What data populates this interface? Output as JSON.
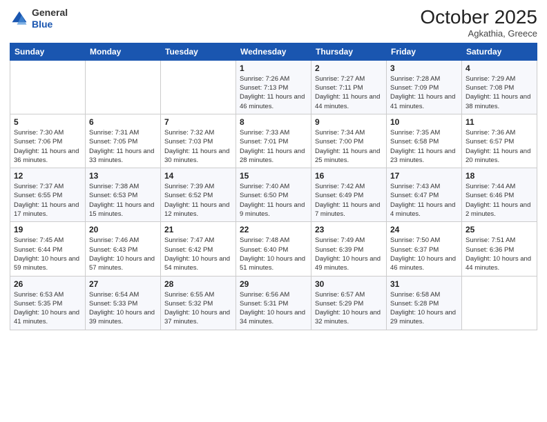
{
  "header": {
    "logo": {
      "general": "General",
      "blue": "Blue"
    },
    "title": "October 2025",
    "subtitle": "Agkathia, Greece"
  },
  "weekdays": [
    "Sunday",
    "Monday",
    "Tuesday",
    "Wednesday",
    "Thursday",
    "Friday",
    "Saturday"
  ],
  "weeks": [
    [
      {
        "day": null
      },
      {
        "day": null
      },
      {
        "day": null
      },
      {
        "day": 1,
        "sunrise": "Sunrise: 7:26 AM",
        "sunset": "Sunset: 7:13 PM",
        "daylight": "Daylight: 11 hours and 46 minutes."
      },
      {
        "day": 2,
        "sunrise": "Sunrise: 7:27 AM",
        "sunset": "Sunset: 7:11 PM",
        "daylight": "Daylight: 11 hours and 44 minutes."
      },
      {
        "day": 3,
        "sunrise": "Sunrise: 7:28 AM",
        "sunset": "Sunset: 7:09 PM",
        "daylight": "Daylight: 11 hours and 41 minutes."
      },
      {
        "day": 4,
        "sunrise": "Sunrise: 7:29 AM",
        "sunset": "Sunset: 7:08 PM",
        "daylight": "Daylight: 11 hours and 38 minutes."
      }
    ],
    [
      {
        "day": 5,
        "sunrise": "Sunrise: 7:30 AM",
        "sunset": "Sunset: 7:06 PM",
        "daylight": "Daylight: 11 hours and 36 minutes."
      },
      {
        "day": 6,
        "sunrise": "Sunrise: 7:31 AM",
        "sunset": "Sunset: 7:05 PM",
        "daylight": "Daylight: 11 hours and 33 minutes."
      },
      {
        "day": 7,
        "sunrise": "Sunrise: 7:32 AM",
        "sunset": "Sunset: 7:03 PM",
        "daylight": "Daylight: 11 hours and 30 minutes."
      },
      {
        "day": 8,
        "sunrise": "Sunrise: 7:33 AM",
        "sunset": "Sunset: 7:01 PM",
        "daylight": "Daylight: 11 hours and 28 minutes."
      },
      {
        "day": 9,
        "sunrise": "Sunrise: 7:34 AM",
        "sunset": "Sunset: 7:00 PM",
        "daylight": "Daylight: 11 hours and 25 minutes."
      },
      {
        "day": 10,
        "sunrise": "Sunrise: 7:35 AM",
        "sunset": "Sunset: 6:58 PM",
        "daylight": "Daylight: 11 hours and 23 minutes."
      },
      {
        "day": 11,
        "sunrise": "Sunrise: 7:36 AM",
        "sunset": "Sunset: 6:57 PM",
        "daylight": "Daylight: 11 hours and 20 minutes."
      }
    ],
    [
      {
        "day": 12,
        "sunrise": "Sunrise: 7:37 AM",
        "sunset": "Sunset: 6:55 PM",
        "daylight": "Daylight: 11 hours and 17 minutes."
      },
      {
        "day": 13,
        "sunrise": "Sunrise: 7:38 AM",
        "sunset": "Sunset: 6:53 PM",
        "daylight": "Daylight: 11 hours and 15 minutes."
      },
      {
        "day": 14,
        "sunrise": "Sunrise: 7:39 AM",
        "sunset": "Sunset: 6:52 PM",
        "daylight": "Daylight: 11 hours and 12 minutes."
      },
      {
        "day": 15,
        "sunrise": "Sunrise: 7:40 AM",
        "sunset": "Sunset: 6:50 PM",
        "daylight": "Daylight: 11 hours and 9 minutes."
      },
      {
        "day": 16,
        "sunrise": "Sunrise: 7:42 AM",
        "sunset": "Sunset: 6:49 PM",
        "daylight": "Daylight: 11 hours and 7 minutes."
      },
      {
        "day": 17,
        "sunrise": "Sunrise: 7:43 AM",
        "sunset": "Sunset: 6:47 PM",
        "daylight": "Daylight: 11 hours and 4 minutes."
      },
      {
        "day": 18,
        "sunrise": "Sunrise: 7:44 AM",
        "sunset": "Sunset: 6:46 PM",
        "daylight": "Daylight: 11 hours and 2 minutes."
      }
    ],
    [
      {
        "day": 19,
        "sunrise": "Sunrise: 7:45 AM",
        "sunset": "Sunset: 6:44 PM",
        "daylight": "Daylight: 10 hours and 59 minutes."
      },
      {
        "day": 20,
        "sunrise": "Sunrise: 7:46 AM",
        "sunset": "Sunset: 6:43 PM",
        "daylight": "Daylight: 10 hours and 57 minutes."
      },
      {
        "day": 21,
        "sunrise": "Sunrise: 7:47 AM",
        "sunset": "Sunset: 6:42 PM",
        "daylight": "Daylight: 10 hours and 54 minutes."
      },
      {
        "day": 22,
        "sunrise": "Sunrise: 7:48 AM",
        "sunset": "Sunset: 6:40 PM",
        "daylight": "Daylight: 10 hours and 51 minutes."
      },
      {
        "day": 23,
        "sunrise": "Sunrise: 7:49 AM",
        "sunset": "Sunset: 6:39 PM",
        "daylight": "Daylight: 10 hours and 49 minutes."
      },
      {
        "day": 24,
        "sunrise": "Sunrise: 7:50 AM",
        "sunset": "Sunset: 6:37 PM",
        "daylight": "Daylight: 10 hours and 46 minutes."
      },
      {
        "day": 25,
        "sunrise": "Sunrise: 7:51 AM",
        "sunset": "Sunset: 6:36 PM",
        "daylight": "Daylight: 10 hours and 44 minutes."
      }
    ],
    [
      {
        "day": 26,
        "sunrise": "Sunrise: 6:53 AM",
        "sunset": "Sunset: 5:35 PM",
        "daylight": "Daylight: 10 hours and 41 minutes."
      },
      {
        "day": 27,
        "sunrise": "Sunrise: 6:54 AM",
        "sunset": "Sunset: 5:33 PM",
        "daylight": "Daylight: 10 hours and 39 minutes."
      },
      {
        "day": 28,
        "sunrise": "Sunrise: 6:55 AM",
        "sunset": "Sunset: 5:32 PM",
        "daylight": "Daylight: 10 hours and 37 minutes."
      },
      {
        "day": 29,
        "sunrise": "Sunrise: 6:56 AM",
        "sunset": "Sunset: 5:31 PM",
        "daylight": "Daylight: 10 hours and 34 minutes."
      },
      {
        "day": 30,
        "sunrise": "Sunrise: 6:57 AM",
        "sunset": "Sunset: 5:29 PM",
        "daylight": "Daylight: 10 hours and 32 minutes."
      },
      {
        "day": 31,
        "sunrise": "Sunrise: 6:58 AM",
        "sunset": "Sunset: 5:28 PM",
        "daylight": "Daylight: 10 hours and 29 minutes."
      },
      {
        "day": null
      }
    ]
  ]
}
